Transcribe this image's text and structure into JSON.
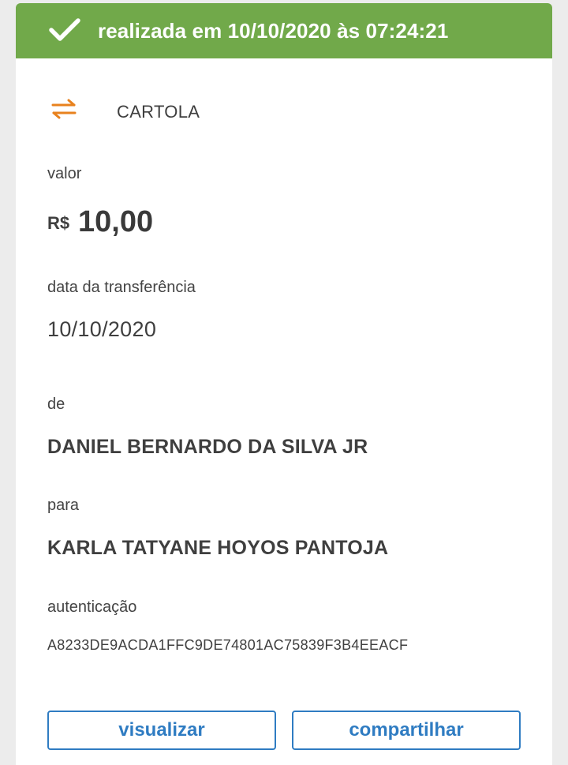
{
  "banner": {
    "icon": "check-icon",
    "text": "realizada em 10/10/2020 às 07:24:21",
    "color": "#71a94a"
  },
  "transaction": {
    "icon": "transfer-arrows-icon",
    "icon_color": "#e8821e",
    "type": "CARTOLA"
  },
  "amount": {
    "label": "valor",
    "currency": "R$",
    "value": "10,00"
  },
  "transfer_date": {
    "label": "data da transferência",
    "value": "10/10/2020"
  },
  "sender": {
    "label": "de",
    "name": "DANIEL BERNARDO DA SILVA JR"
  },
  "recipient": {
    "label": "para",
    "name": "KARLA TATYANE HOYOS PANTOJA"
  },
  "authentication": {
    "label": "autenticação",
    "code": "A8233DE9ACDA1FFC9DE74801AC75839F3B4EEACF"
  },
  "actions": {
    "view_label": "visualizar",
    "share_label": "compartilhar",
    "accent_color": "#2f7cc2"
  }
}
